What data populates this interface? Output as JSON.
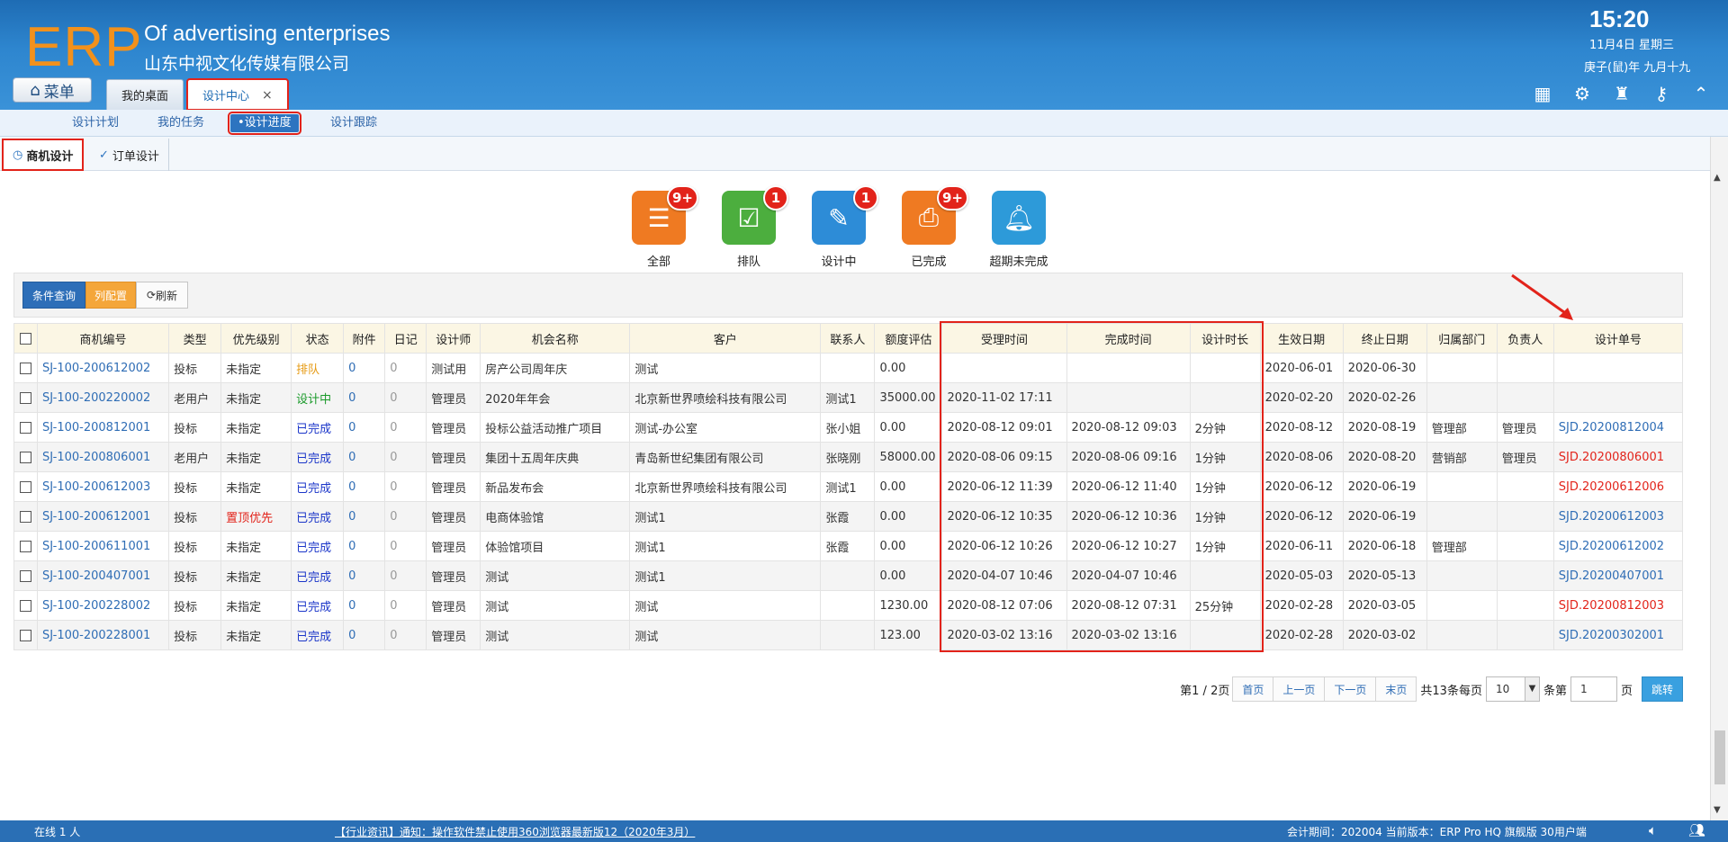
{
  "header": {
    "logo": "ERP",
    "company_en": "Of advertising enterprises",
    "company_cn": "山东中视文化传媒有限公司",
    "time": "15:20",
    "date": "11月4日 星期三",
    "lunar": "庚子(鼠)年 九月十九",
    "menu_label": "菜单",
    "tabs": [
      {
        "label": "我的桌面"
      },
      {
        "label": "设计中心",
        "close": "×"
      }
    ]
  },
  "subnav": [
    "设计计划",
    "我的任务",
    "•设计进度",
    "设计跟踪"
  ],
  "panel_tabs": [
    "商机设计",
    "订单设计"
  ],
  "status_icons": [
    {
      "label": "全部",
      "badge": "9+",
      "color": "#ef7a22"
    },
    {
      "label": "排队",
      "badge": "1",
      "color": "#4cae3e"
    },
    {
      "label": "设计中",
      "badge": "1",
      "color": "#2d8cd7"
    },
    {
      "label": "已完成",
      "badge": "9+",
      "color": "#ef7a22"
    },
    {
      "label": "超期未完成",
      "badge": "",
      "color": "#2d9ad9"
    }
  ],
  "toolbar": {
    "query": "条件查询",
    "columns": "列配置",
    "refresh": "刷新"
  },
  "table": {
    "headers": [
      "商机编号",
      "类型",
      "优先级别",
      "状态",
      "附件",
      "日记",
      "设计师",
      "机会名称",
      "客户",
      "联系人",
      "额度评估",
      "受理时间",
      "完成时间",
      "设计时长",
      "生效日期",
      "终止日期",
      "归属部门",
      "负责人",
      "设计单号"
    ],
    "rows": [
      [
        "SJ-100-200612002",
        "投标",
        "未指定",
        "排队",
        "0",
        "0",
        "测试用",
        "房产公司周年庆",
        "测试",
        "",
        "0.00",
        "",
        "",
        "",
        "2020-06-01",
        "2020-06-30",
        "",
        "",
        ""
      ],
      [
        "SJ-100-200220002",
        "老用户",
        "未指定",
        "设计中",
        "0",
        "0",
        "管理员",
        "2020年年会",
        "北京新世界喷绘科技有限公司",
        "测试1",
        "35000.00",
        "2020-11-02 17:11",
        "",
        "",
        "2020-02-20",
        "2020-02-26",
        "",
        "",
        ""
      ],
      [
        "SJ-100-200812001",
        "投标",
        "未指定",
        "已完成",
        "0",
        "0",
        "管理员",
        "投标公益活动推广项目",
        "测试-办公室",
        "张小姐",
        "0.00",
        "2020-08-12 09:01",
        "2020-08-12 09:03",
        "2分钟",
        "2020-08-12",
        "2020-08-19",
        "管理部",
        "管理员",
        "SJD.20200812004"
      ],
      [
        "SJ-100-200806001",
        "老用户",
        "未指定",
        "已完成",
        "0",
        "0",
        "管理员",
        "集团十五周年庆典",
        "青岛新世纪集团有限公司",
        "张晓刚",
        "58000.00",
        "2020-08-06 09:15",
        "2020-08-06 09:16",
        "1分钟",
        "2020-08-06",
        "2020-08-20",
        "营销部",
        "管理员",
        "SJD.20200806001"
      ],
      [
        "SJ-100-200612003",
        "投标",
        "未指定",
        "已完成",
        "0",
        "0",
        "管理员",
        "新品发布会",
        "北京新世界喷绘科技有限公司",
        "测试1",
        "0.00",
        "2020-06-12 11:39",
        "2020-06-12 11:40",
        "1分钟",
        "2020-06-12",
        "2020-06-19",
        "",
        "",
        "SJD.20200612006"
      ],
      [
        "SJ-100-200612001",
        "投标",
        "置顶优先",
        "已完成",
        "0",
        "0",
        "管理员",
        "电商体验馆",
        "测试1",
        "张霞",
        "0.00",
        "2020-06-12 10:35",
        "2020-06-12 10:36",
        "1分钟",
        "2020-06-12",
        "2020-06-19",
        "",
        "",
        "SJD.20200612003"
      ],
      [
        "SJ-100-200611001",
        "投标",
        "未指定",
        "已完成",
        "0",
        "0",
        "管理员",
        "体验馆项目",
        "测试1",
        "张霞",
        "0.00",
        "2020-06-12 10:26",
        "2020-06-12 10:27",
        "1分钟",
        "2020-06-11",
        "2020-06-18",
        "管理部",
        "",
        "SJD.20200612002"
      ],
      [
        "SJ-100-200407001",
        "投标",
        "未指定",
        "已完成",
        "0",
        "0",
        "管理员",
        "测试",
        "测试1",
        "",
        "0.00",
        "2020-04-07 10:46",
        "2020-04-07 10:46",
        "",
        "2020-05-03",
        "2020-05-13",
        "",
        "",
        "SJD.20200407001"
      ],
      [
        "SJ-100-200228002",
        "投标",
        "未指定",
        "已完成",
        "0",
        "0",
        "管理员",
        "测试",
        "测试",
        "",
        "1230.00",
        "2020-08-12 07:06",
        "2020-08-12 07:31",
        "25分钟",
        "2020-02-28",
        "2020-03-05",
        "",
        "",
        "SJD.20200812003"
      ],
      [
        "SJ-100-200228001",
        "投标",
        "未指定",
        "已完成",
        "0",
        "0",
        "管理员",
        "测试",
        "测试",
        "",
        "123.00",
        "2020-03-02 13:16",
        "2020-03-02 13:16",
        "",
        "2020-02-28",
        "2020-03-02",
        "",
        "",
        "SJD.20200302001"
      ]
    ],
    "red_codes": [
      "SJD.20200806001",
      "SJD.20200612006",
      "SJD.20200812003"
    ]
  },
  "pager": {
    "page_info": "第1 / 2页",
    "first": "首页",
    "prev": "上一页",
    "next": "下一页",
    "last": "末页",
    "total": "共13条每页",
    "per_page": "10",
    "unit": "条第",
    "page_input": "1",
    "page_suffix": "页",
    "go": "跳转"
  },
  "footer": {
    "online": "在线  1  人",
    "news": "【行业资讯】通知：操作软件禁止使用360浏览器最新版12（2020年3月）",
    "version": "会计期间：202004  当前版本：ERP Pro HQ 旗舰版 30用户端"
  }
}
